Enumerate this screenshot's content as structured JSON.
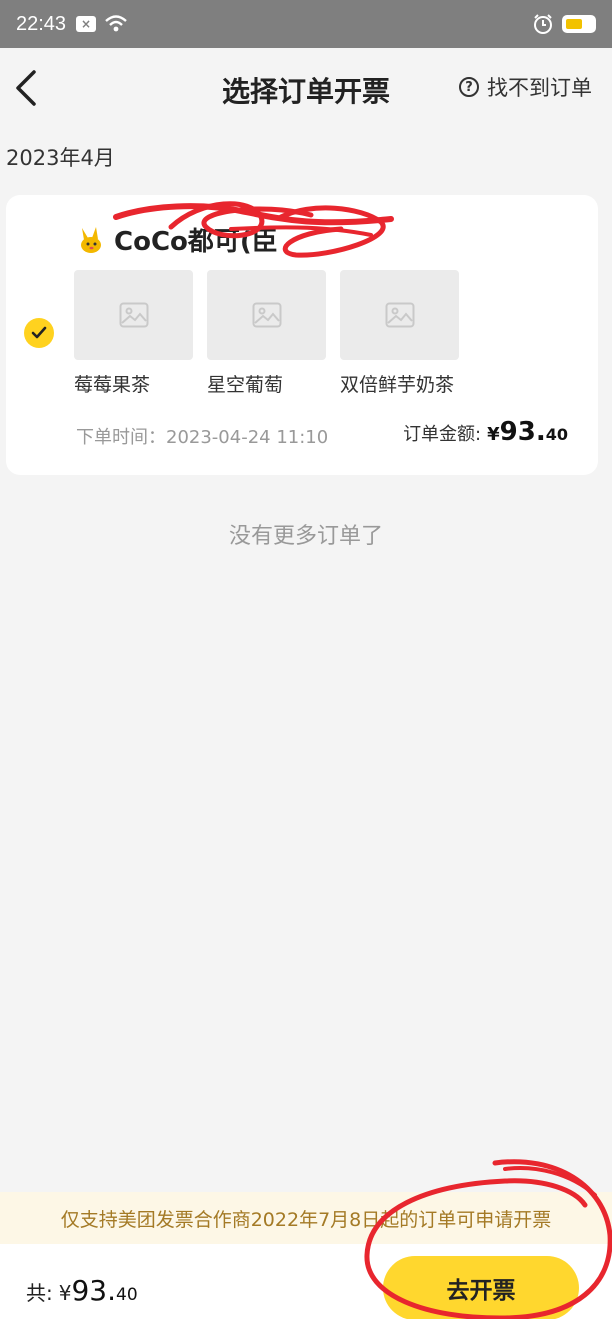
{
  "status_bar": {
    "time": "22:43",
    "notif_glyph": "×"
  },
  "header": {
    "title": "选择订单开票",
    "help_label": "找不到订单",
    "help_glyph": "?"
  },
  "month_label": "2023年4月",
  "order": {
    "selected": true,
    "shop_name": "CoCo都可(臣",
    "products": [
      {
        "name": "莓莓果茶"
      },
      {
        "name": "星空葡萄"
      },
      {
        "name": "双倍鲜芋奶茶"
      }
    ],
    "order_time": "下单时间：2023-04-24 11:10",
    "amount_label": "订单金额:",
    "amount_currency": "¥",
    "amount_int": "93.",
    "amount_dec": "40"
  },
  "no_more_text": "没有更多订单了",
  "notice_text": "仅支持美团发票合作商2022年7月8日起的订单可申请开票",
  "footer": {
    "total_label": "共:",
    "total_currency": "¥",
    "total_int": "93.",
    "total_dec": "40",
    "invoice_button": "去开票"
  },
  "colors": {
    "accent": "#ffd72e",
    "annotation": "#e8262e",
    "notice_text": "#a47a25"
  }
}
